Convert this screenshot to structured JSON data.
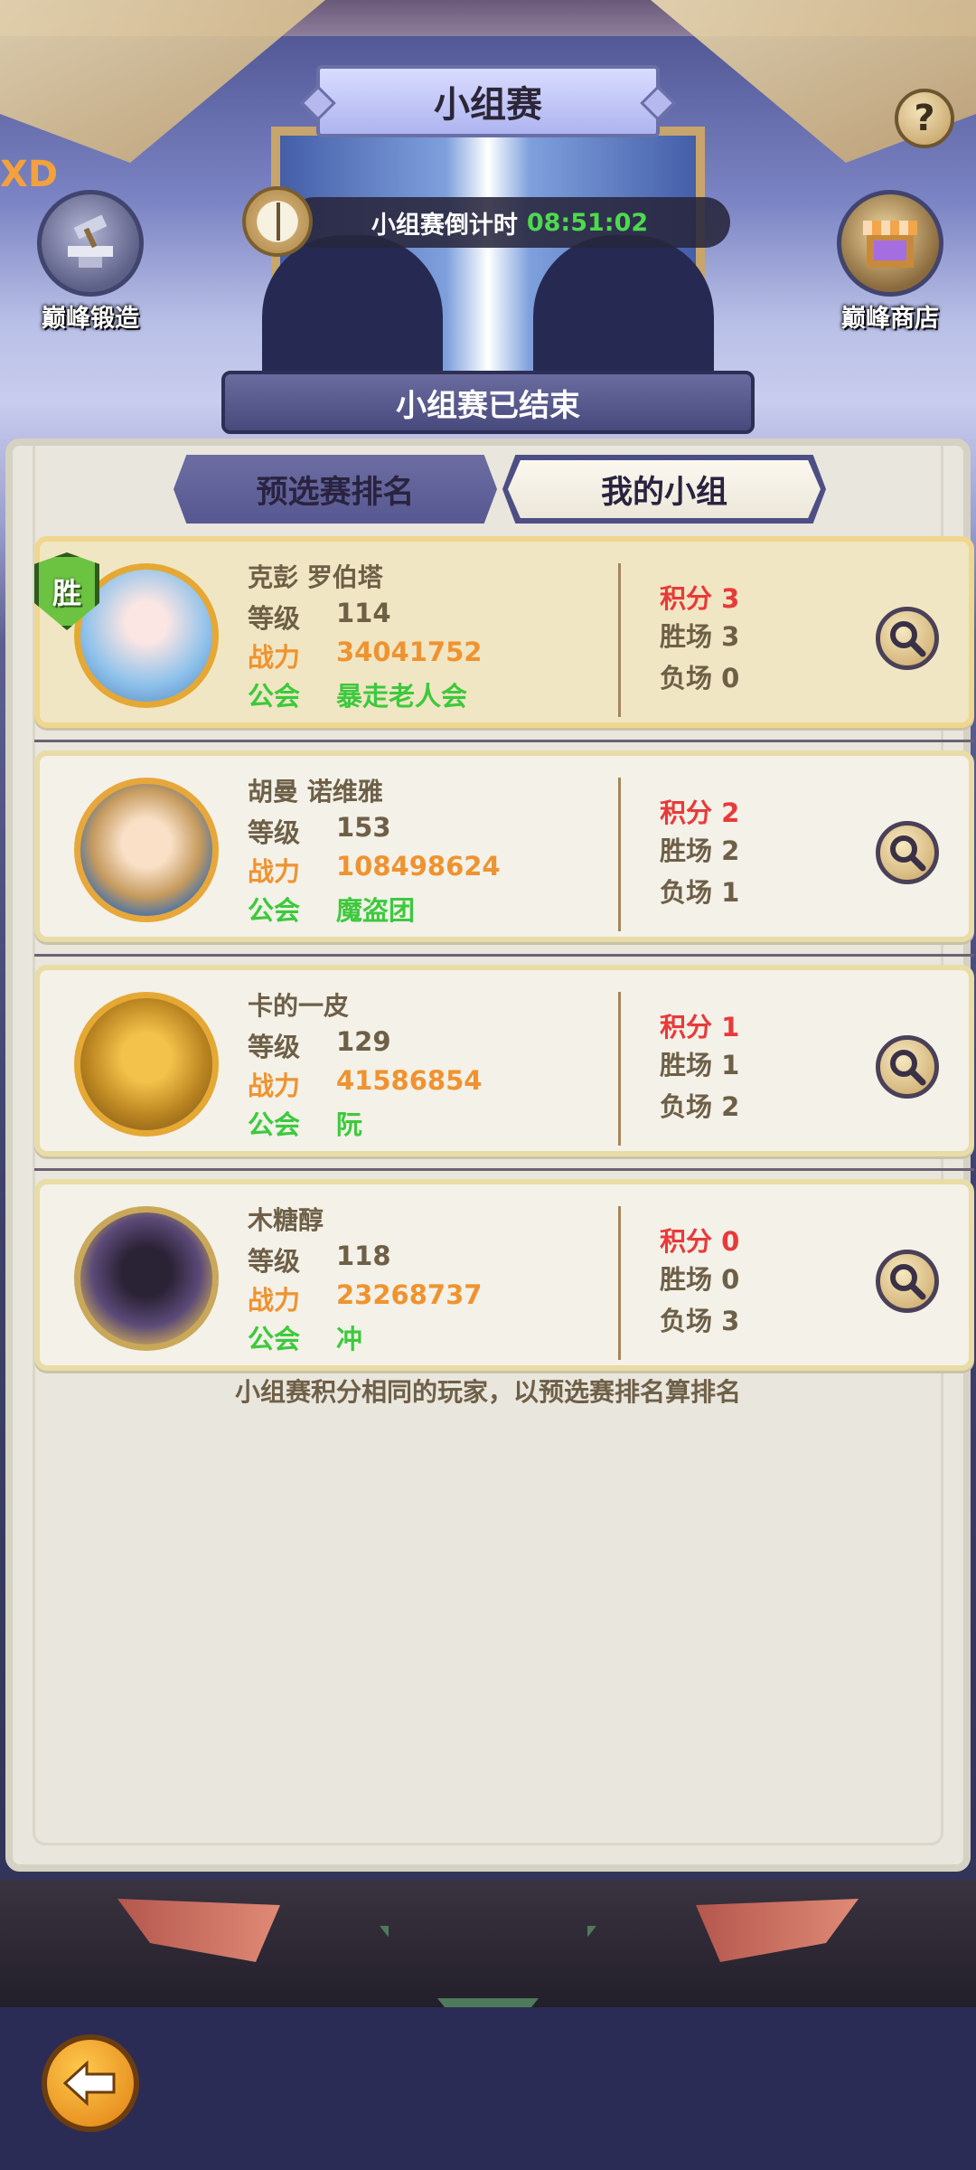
{
  "header": {
    "title": "小组赛",
    "help_label": "?",
    "countdown_label": "小组赛倒计时",
    "countdown_time": "08:51:02",
    "left_button": {
      "label": "巅峰锻造",
      "icon": "anvil-icon"
    },
    "right_button": {
      "label": "巅峰商店",
      "icon": "shop-icon"
    },
    "corner_mark": "XD"
  },
  "status_banner": "小组赛已结束",
  "tabs": [
    {
      "label": "预选赛排名",
      "active": false
    },
    {
      "label": "我的小组",
      "active": true
    }
  ],
  "field_labels": {
    "level": "等级",
    "power": "战力",
    "guild": "公会"
  },
  "players": [
    {
      "name": "克彭 罗伯塔",
      "level": "114",
      "power": "34041752",
      "guild": "暴走老人会",
      "points": "积分 3",
      "wins": "胜场 3",
      "losses": "负场 0",
      "winner_badge": "胜"
    },
    {
      "name": "胡曼 诺维雅",
      "level": "153",
      "power": "108498624",
      "guild": "魔盗团",
      "points": "积分 2",
      "wins": "胜场 2",
      "losses": "负场 1"
    },
    {
      "name": "卡的一皮",
      "level": "129",
      "power": "41586854",
      "guild": "阮",
      "points": "积分 1",
      "wins": "胜场 1",
      "losses": "负场 2"
    },
    {
      "name": "木糖醇",
      "level": "118",
      "power": "23268737",
      "guild": "冲",
      "points": "积分 0",
      "wins": "胜场 0",
      "losses": "负场 3"
    }
  ],
  "footnote": "小组赛积分相同的玩家，以预选赛排名算排名",
  "colors": {
    "power": "#ef9330",
    "guild": "#3dc93d",
    "points": "#e83a3a",
    "countdown": "#4ed94e"
  }
}
